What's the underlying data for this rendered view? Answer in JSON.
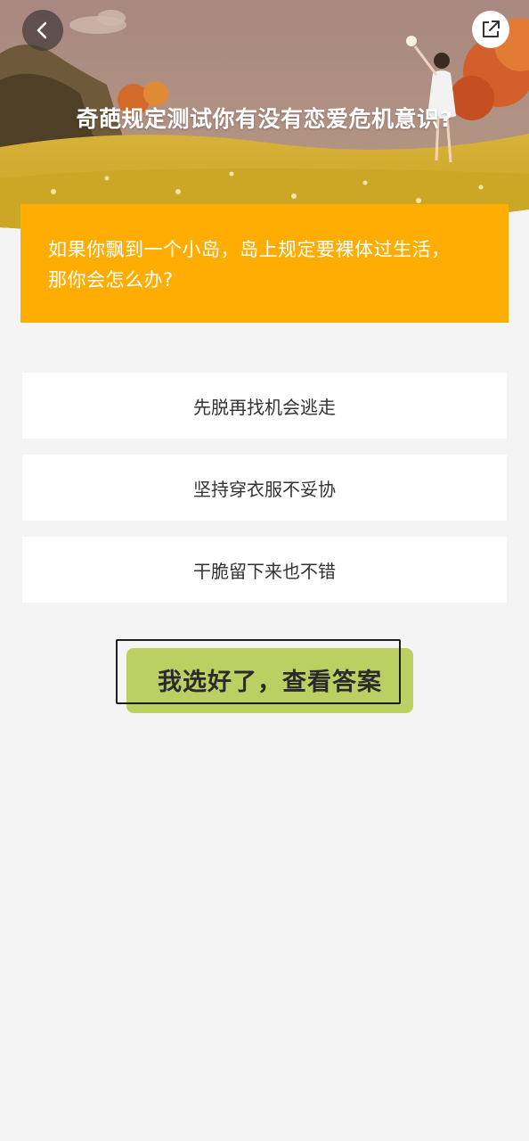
{
  "header": {
    "title": "奇葩规定测试你有没有恋爱危机意识?",
    "back_icon": "back-arrow-icon",
    "share_icon": "share-icon"
  },
  "question": {
    "text": "如果你飘到一个小岛，岛上规定要裸体过生活，那你会怎么办?"
  },
  "options": [
    {
      "label": "先脱再找机会逃走"
    },
    {
      "label": "坚持穿衣服不妥协"
    },
    {
      "label": "干脆留下来也不错"
    }
  ],
  "submit": {
    "label": "我选好了，查看答案"
  },
  "colors": {
    "question_bg": "#ffad03",
    "submit_bg": "#bccf63",
    "page_bg": "#f4f4f4"
  }
}
